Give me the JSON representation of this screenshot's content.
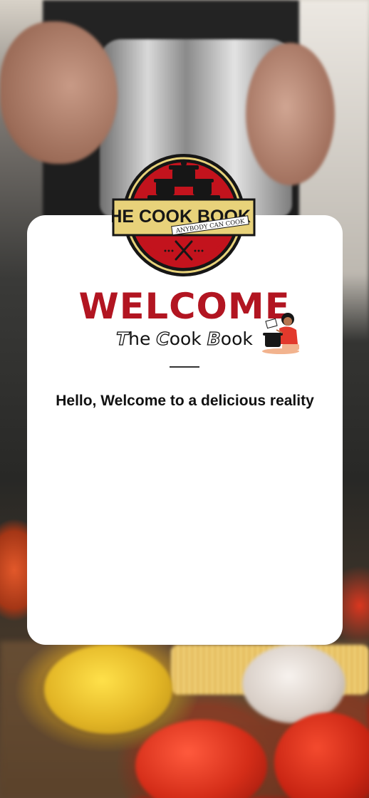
{
  "logo": {
    "title": "THE COOK BOOK",
    "slogan": "ANYBODY CAN COOK"
  },
  "welcome": {
    "heading": "WELCOME",
    "subtitle_parts": [
      "T",
      "he ",
      "C",
      "ook ",
      "B",
      "ook"
    ]
  },
  "tagline": "Hello, Welcome to a delicious reality",
  "colors": {
    "brand_red": "#b21521",
    "brand_gold": "#e8d27a",
    "card": "#ffffff"
  }
}
